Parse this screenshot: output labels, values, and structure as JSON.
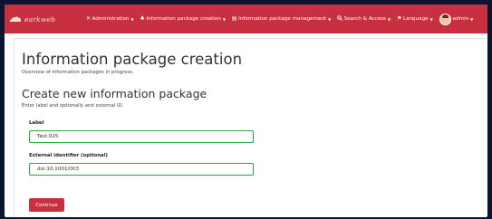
{
  "brand": {
    "name": "earkweb"
  },
  "nav": {
    "items": [
      {
        "icon": "wrench-icon",
        "glyph": "✕",
        "label": "Administration"
      },
      {
        "icon": "sitemap-icon",
        "glyph": "♣",
        "label": "Information package creation"
      },
      {
        "icon": "table-icon",
        "glyph": "▤",
        "label": "Information package management"
      },
      {
        "icon": "search-icon",
        "glyph": "🔍",
        "label": "Search & Access"
      },
      {
        "icon": "flag-icon",
        "glyph": "⚑",
        "label": "Language"
      }
    ],
    "user": "admin"
  },
  "page": {
    "title": "Information package creation",
    "subtitle": "Overview of information packages in progress."
  },
  "section": {
    "title": "Create new information package",
    "subtitle": "Enter label and optionally and external ID."
  },
  "form": {
    "label_label": "Label",
    "label_value": "Test.025",
    "external_id_label": "External identifier (optional)",
    "external_id_value": "doi:10.1001/003",
    "submit": "Continue"
  },
  "colors": {
    "navbar": "#c8303f",
    "button": "#c8303f",
    "field_border": "#28a745",
    "background": "#0a1530"
  }
}
